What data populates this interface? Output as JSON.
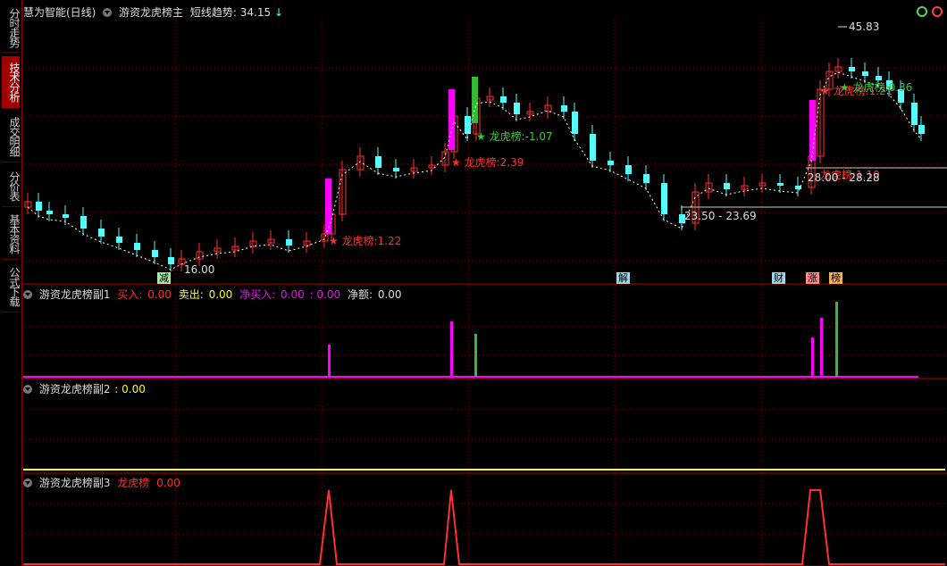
{
  "title_bar": {
    "stock_name": "慧为智能(日线)",
    "indicator_name": "游资龙虎榜主",
    "trend_label": "短线趋势:",
    "trend_value": "34.15",
    "trend_arrow": "↓"
  },
  "side_tabs": [
    {
      "label": "分时走势",
      "active": false
    },
    {
      "label": "技术分析",
      "active": true
    },
    {
      "label": "成交明细",
      "active": false
    },
    {
      "label": "分价表",
      "active": false
    },
    {
      "label": "基本资料",
      "active": false
    },
    {
      "label": "公式下载",
      "active": false
    }
  ],
  "main_chart": {
    "high_label": "45.83",
    "low_label": "16.00",
    "annotations": [
      {
        "text": "★ 龙虎榜:1.22",
        "color": "#ff3030"
      },
      {
        "text": "★ 龙虎榜:2.39",
        "color": "#ff3030"
      },
      {
        "text": "★ 龙虎榜:-1.07",
        "color": "#33cc33"
      },
      {
        "text": "★ 龙虎榜:1.21",
        "color": "#ff3030"
      },
      {
        "text": "★ 龙虎榜:0.36",
        "color": "#33cc33"
      },
      {
        "text": "龙虎榜:1.10",
        "color": "#ff3030"
      }
    ],
    "ranges": [
      {
        "text": "23.50 - 23.69"
      },
      {
        "text": "28.00 - 28.28"
      }
    ],
    "event_tags": [
      {
        "text": "减",
        "color": "#a8e8a8"
      },
      {
        "text": "解",
        "color": "#9fd6ea"
      },
      {
        "text": "财",
        "color": "#9fd6ea"
      },
      {
        "text": "涨",
        "color": "#ff8a8a"
      },
      {
        "text": "榜",
        "color": "#f0b060"
      }
    ]
  },
  "sub1": {
    "name": "游资龙虎榜副1",
    "buy_label": "买入:",
    "buy_value": "0.00",
    "sell_label": "卖出:",
    "sell_value": "0.00",
    "net_buy_label": "净买入:",
    "net_buy_value": "0.00",
    "net_buy_value2": ": 0.00",
    "net_amount_label": "净额:",
    "net_amount_value": "0.00"
  },
  "sub2": {
    "name": "游资龙虎榜副2",
    "value": ": 0.00"
  },
  "sub3": {
    "name": "游资龙虎榜副3",
    "label": "龙虎榜",
    "value": "0.00"
  },
  "colors": {
    "up": "#ff3030",
    "down": "#54fcfc",
    "magenta": "#ff00ff",
    "green": "#33bb33",
    "yellow": "#ffff00",
    "grid": "#8b0000"
  }
}
